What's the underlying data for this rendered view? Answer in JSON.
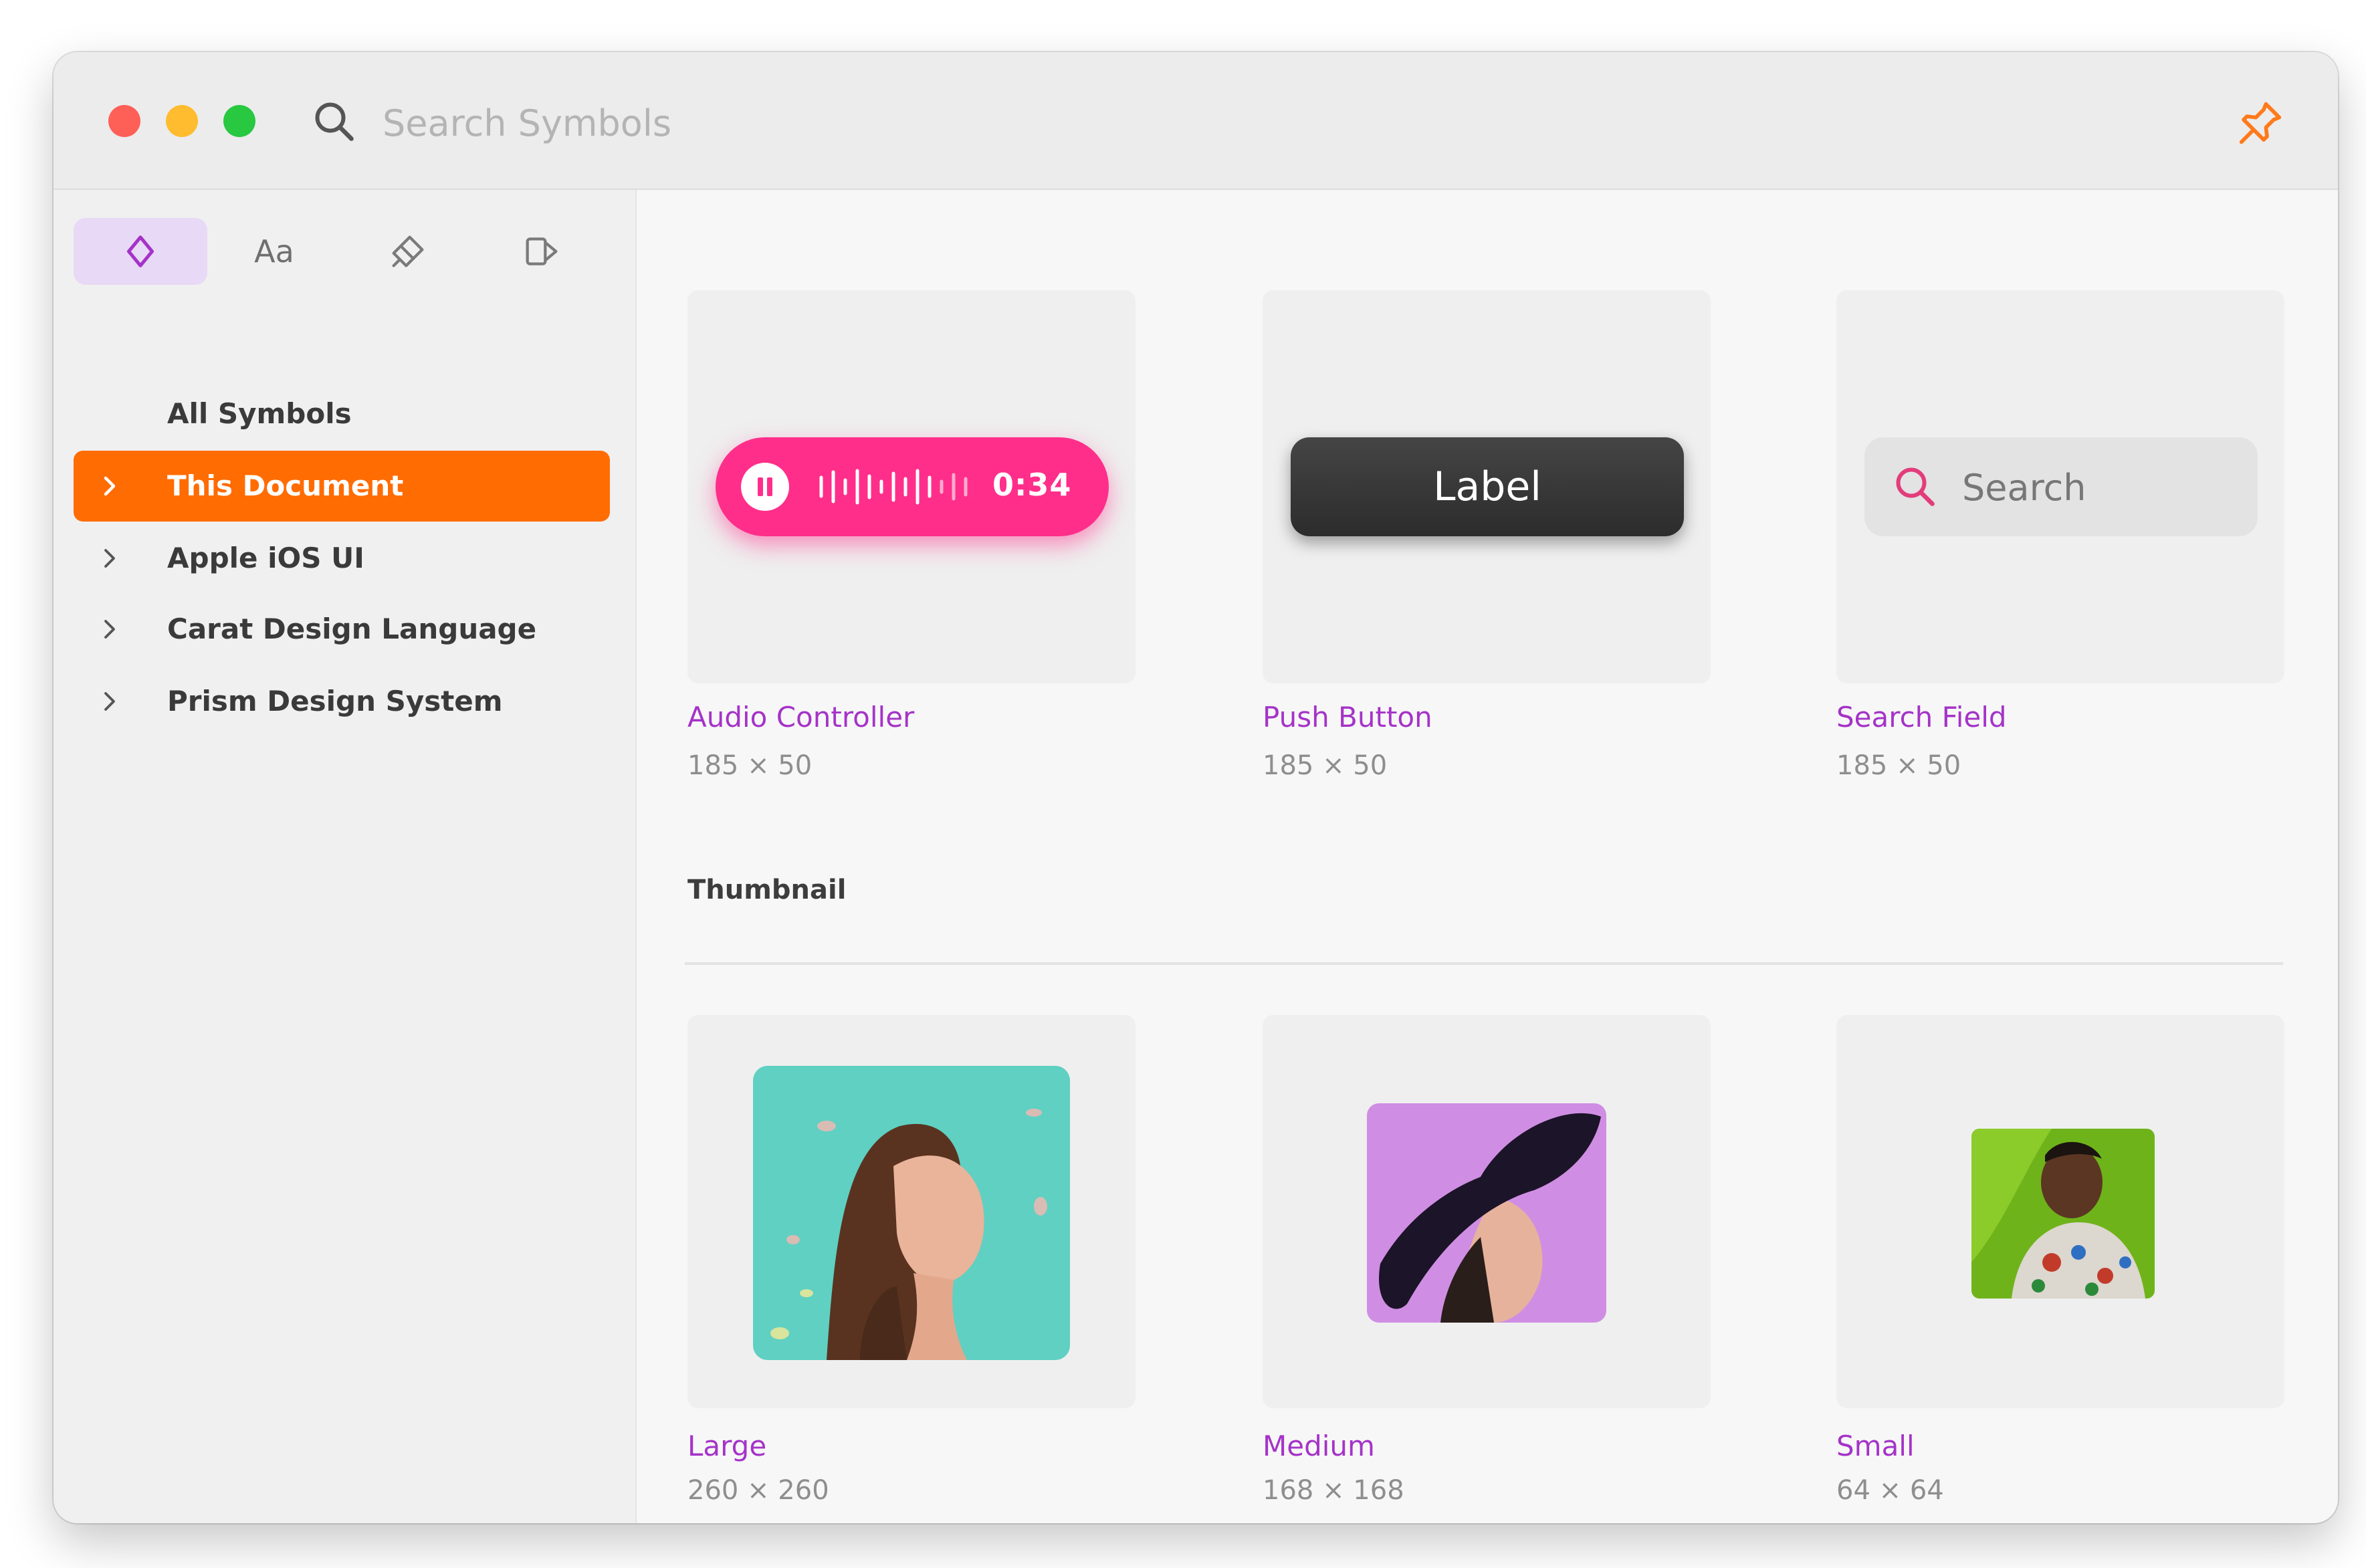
{
  "window": {
    "traffic_lights": {
      "close": "#fe5f57",
      "minimize": "#febc2e",
      "zoom": "#28c840"
    },
    "search": {
      "placeholder": "Search Symbols",
      "icon": "search-icon"
    },
    "pin_icon": "pin-icon",
    "accent": "#ff6c02"
  },
  "sidebar": {
    "segments": [
      {
        "name": "symbols",
        "icon": "diamond-icon",
        "active": true
      },
      {
        "name": "text-styles",
        "label": "Aa",
        "active": false
      },
      {
        "name": "color-fill",
        "icon": "paint-icon",
        "active": false
      },
      {
        "name": "layer-styles",
        "icon": "layer-style-icon",
        "active": false
      }
    ],
    "items": [
      {
        "label": "All Symbols",
        "chevron": false,
        "selected": false
      },
      {
        "label": "This Document",
        "chevron": true,
        "selected": true
      },
      {
        "label": "Apple iOS UI",
        "chevron": true,
        "selected": false
      },
      {
        "label": "Carat Design Language",
        "chevron": true,
        "selected": false
      },
      {
        "label": "Prism Design System",
        "chevron": true,
        "selected": false
      }
    ]
  },
  "main": {
    "cards": [
      {
        "title": "Audio Controller",
        "size": "185 × 50",
        "preview": {
          "time": "0:34",
          "color": "#ff2e8a"
        }
      },
      {
        "title": "Push Button",
        "size": "185 × 50",
        "preview": {
          "label": "Label"
        }
      },
      {
        "title": "Search Field",
        "size": "185 × 50",
        "preview": {
          "placeholder": "Search",
          "icon": "search-icon"
        }
      }
    ],
    "section": {
      "title": "Thumbnail"
    },
    "thumbnails": [
      {
        "title": "Large",
        "size": "260 × 260",
        "bg": "#5fd0c2"
      },
      {
        "title": "Medium",
        "size": "168 × 168",
        "bg": "#cf8ee3"
      },
      {
        "title": "Small",
        "size": "64 × 64",
        "bg": "#6fb31a"
      }
    ],
    "title_color": "#a533c8"
  }
}
